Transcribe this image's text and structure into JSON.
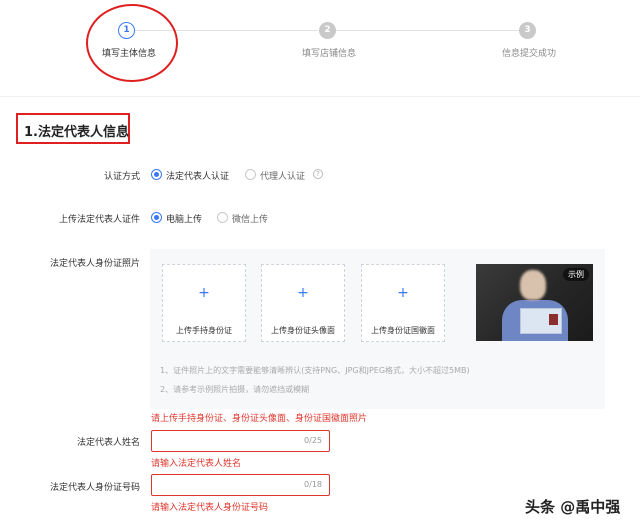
{
  "steps": [
    {
      "number": "1",
      "label": "填写主体信息",
      "active": true
    },
    {
      "number": "2",
      "label": "填写店铺信息",
      "active": false
    },
    {
      "number": "3",
      "label": "信息提交成功",
      "active": false
    }
  ],
  "section": {
    "title": "1.法定代表人信息"
  },
  "auth_method": {
    "label": "认证方式",
    "options": [
      "法定代表人认证",
      "代理人认证"
    ],
    "selected": "法定代表人认证",
    "help_icon": "question-circle-icon"
  },
  "upload_method": {
    "label": "上传法定代表人证件",
    "options": [
      "电脑上传",
      "微信上传"
    ],
    "selected": "电脑上传"
  },
  "id_photos": {
    "label": "法定代表人身份证照片",
    "cards": [
      {
        "plus": "+",
        "label": "上传手持身份证"
      },
      {
        "plus": "+",
        "label": "上传身份证头像面"
      },
      {
        "plus": "+",
        "label": "上传身份证国徽面"
      }
    ],
    "sample_badge": "示例",
    "notes": [
      "1、证件照片上的文字需要能够清晰辨认(支持PNG、JPG和JPEG格式，大小不超过5MB)",
      "2、请参考示例照片拍摄，请勿遮挡或模糊"
    ],
    "error": "请上传手持身份证、身份证头像面、身份证国徽面照片"
  },
  "name_field": {
    "label": "法定代表人姓名",
    "value": "",
    "counter": "0/25",
    "error": "请输入法定代表人姓名"
  },
  "id_number_field": {
    "label": "法定代表人身份证号码",
    "value": "",
    "counter": "0/18",
    "error": "请输入法定代表人身份证号码"
  },
  "watermark": "头条 @禹中强",
  "colors": {
    "accent": "#3a78f2",
    "error": "#e0352b",
    "highlight": "#e02020"
  }
}
